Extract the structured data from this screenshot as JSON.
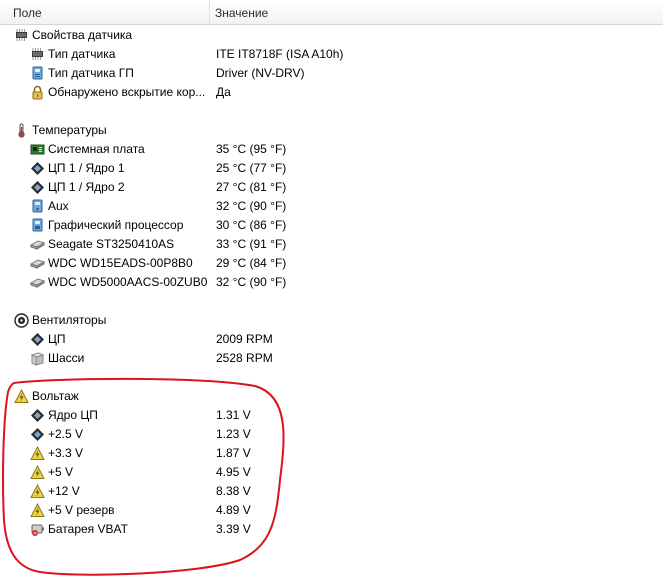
{
  "columns": {
    "field": "Поле",
    "value": "Значение"
  },
  "sections": {
    "sensor_props": {
      "title": "Свойства датчика",
      "items": [
        {
          "label": "Тип датчика",
          "value": "ITE IT8718F  (ISA A10h)",
          "icon": "chip-icon"
        },
        {
          "label": "Тип датчика ГП",
          "value": "Driver  (NV-DRV)",
          "icon": "gpu-sensor-icon"
        },
        {
          "label": "Обнаружено вскрытие кор...",
          "value": "Да",
          "icon": "lock-icon"
        }
      ]
    },
    "temperatures": {
      "title": "Температуры",
      "items": [
        {
          "label": "Системная плата",
          "value": "35 °C  (95 °F)",
          "icon": "motherboard-icon"
        },
        {
          "label": "ЦП 1 / Ядро 1",
          "value": "25 °C  (77 °F)",
          "icon": "cpu-icon"
        },
        {
          "label": "ЦП 1 / Ядро 2",
          "value": "27 °C  (81 °F)",
          "icon": "cpu-icon"
        },
        {
          "label": "Aux",
          "value": "32 °C  (90 °F)",
          "icon": "computer-icon"
        },
        {
          "label": "Графический процессор",
          "value": "30 °C  (86 °F)",
          "icon": "gpu-icon"
        },
        {
          "label": "Seagate ST3250410AS",
          "value": "33 °C  (91 °F)",
          "icon": "hdd-icon"
        },
        {
          "label": "WDC WD15EADS-00P8B0",
          "value": "29 °C  (84 °F)",
          "icon": "hdd-icon"
        },
        {
          "label": "WDC WD5000AACS-00ZUB0",
          "value": "32 °C  (90 °F)",
          "icon": "hdd-icon"
        }
      ]
    },
    "fans": {
      "title": "Вентиляторы",
      "items": [
        {
          "label": "ЦП",
          "value": "2009 RPM",
          "icon": "cpu-icon"
        },
        {
          "label": "Шасси",
          "value": "2528 RPM",
          "icon": "chassis-icon"
        }
      ]
    },
    "voltage": {
      "title": "Вольтаж",
      "items": [
        {
          "label": "Ядро ЦП",
          "value": "1.31 V",
          "icon": "cpu-icon"
        },
        {
          "label": "+2.5 V",
          "value": "1.23 V",
          "icon": "cpu-icon"
        },
        {
          "label": "+3.3 V",
          "value": "1.87 V",
          "icon": "voltage-icon"
        },
        {
          "label": "+5 V",
          "value": "4.95 V",
          "icon": "voltage-icon"
        },
        {
          "label": "+12 V",
          "value": "8.38 V",
          "icon": "voltage-icon"
        },
        {
          "label": "+5 V резерв",
          "value": "4.89 V",
          "icon": "voltage-icon"
        },
        {
          "label": "Батарея VBAT",
          "value": "3.39 V",
          "icon": "battery-icon"
        }
      ]
    }
  },
  "colors": {
    "annotation": "#d9141b",
    "header_bg": "#f1f2f4"
  }
}
